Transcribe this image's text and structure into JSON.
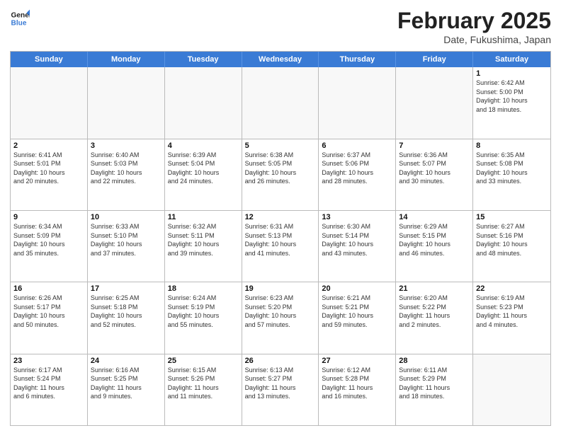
{
  "logo": {
    "line1": "General",
    "line2": "Blue"
  },
  "title": "February 2025",
  "subtitle": "Date, Fukushima, Japan",
  "weekdays": [
    "Sunday",
    "Monday",
    "Tuesday",
    "Wednesday",
    "Thursday",
    "Friday",
    "Saturday"
  ],
  "weeks": [
    [
      {
        "day": "",
        "info": ""
      },
      {
        "day": "",
        "info": ""
      },
      {
        "day": "",
        "info": ""
      },
      {
        "day": "",
        "info": ""
      },
      {
        "day": "",
        "info": ""
      },
      {
        "day": "",
        "info": ""
      },
      {
        "day": "1",
        "info": "Sunrise: 6:42 AM\nSunset: 5:00 PM\nDaylight: 10 hours\nand 18 minutes."
      }
    ],
    [
      {
        "day": "2",
        "info": "Sunrise: 6:41 AM\nSunset: 5:01 PM\nDaylight: 10 hours\nand 20 minutes."
      },
      {
        "day": "3",
        "info": "Sunrise: 6:40 AM\nSunset: 5:03 PM\nDaylight: 10 hours\nand 22 minutes."
      },
      {
        "day": "4",
        "info": "Sunrise: 6:39 AM\nSunset: 5:04 PM\nDaylight: 10 hours\nand 24 minutes."
      },
      {
        "day": "5",
        "info": "Sunrise: 6:38 AM\nSunset: 5:05 PM\nDaylight: 10 hours\nand 26 minutes."
      },
      {
        "day": "6",
        "info": "Sunrise: 6:37 AM\nSunset: 5:06 PM\nDaylight: 10 hours\nand 28 minutes."
      },
      {
        "day": "7",
        "info": "Sunrise: 6:36 AM\nSunset: 5:07 PM\nDaylight: 10 hours\nand 30 minutes."
      },
      {
        "day": "8",
        "info": "Sunrise: 6:35 AM\nSunset: 5:08 PM\nDaylight: 10 hours\nand 33 minutes."
      }
    ],
    [
      {
        "day": "9",
        "info": "Sunrise: 6:34 AM\nSunset: 5:09 PM\nDaylight: 10 hours\nand 35 minutes."
      },
      {
        "day": "10",
        "info": "Sunrise: 6:33 AM\nSunset: 5:10 PM\nDaylight: 10 hours\nand 37 minutes."
      },
      {
        "day": "11",
        "info": "Sunrise: 6:32 AM\nSunset: 5:11 PM\nDaylight: 10 hours\nand 39 minutes."
      },
      {
        "day": "12",
        "info": "Sunrise: 6:31 AM\nSunset: 5:13 PM\nDaylight: 10 hours\nand 41 minutes."
      },
      {
        "day": "13",
        "info": "Sunrise: 6:30 AM\nSunset: 5:14 PM\nDaylight: 10 hours\nand 43 minutes."
      },
      {
        "day": "14",
        "info": "Sunrise: 6:29 AM\nSunset: 5:15 PM\nDaylight: 10 hours\nand 46 minutes."
      },
      {
        "day": "15",
        "info": "Sunrise: 6:27 AM\nSunset: 5:16 PM\nDaylight: 10 hours\nand 48 minutes."
      }
    ],
    [
      {
        "day": "16",
        "info": "Sunrise: 6:26 AM\nSunset: 5:17 PM\nDaylight: 10 hours\nand 50 minutes."
      },
      {
        "day": "17",
        "info": "Sunrise: 6:25 AM\nSunset: 5:18 PM\nDaylight: 10 hours\nand 52 minutes."
      },
      {
        "day": "18",
        "info": "Sunrise: 6:24 AM\nSunset: 5:19 PM\nDaylight: 10 hours\nand 55 minutes."
      },
      {
        "day": "19",
        "info": "Sunrise: 6:23 AM\nSunset: 5:20 PM\nDaylight: 10 hours\nand 57 minutes."
      },
      {
        "day": "20",
        "info": "Sunrise: 6:21 AM\nSunset: 5:21 PM\nDaylight: 10 hours\nand 59 minutes."
      },
      {
        "day": "21",
        "info": "Sunrise: 6:20 AM\nSunset: 5:22 PM\nDaylight: 11 hours\nand 2 minutes."
      },
      {
        "day": "22",
        "info": "Sunrise: 6:19 AM\nSunset: 5:23 PM\nDaylight: 11 hours\nand 4 minutes."
      }
    ],
    [
      {
        "day": "23",
        "info": "Sunrise: 6:17 AM\nSunset: 5:24 PM\nDaylight: 11 hours\nand 6 minutes."
      },
      {
        "day": "24",
        "info": "Sunrise: 6:16 AM\nSunset: 5:25 PM\nDaylight: 11 hours\nand 9 minutes."
      },
      {
        "day": "25",
        "info": "Sunrise: 6:15 AM\nSunset: 5:26 PM\nDaylight: 11 hours\nand 11 minutes."
      },
      {
        "day": "26",
        "info": "Sunrise: 6:13 AM\nSunset: 5:27 PM\nDaylight: 11 hours\nand 13 minutes."
      },
      {
        "day": "27",
        "info": "Sunrise: 6:12 AM\nSunset: 5:28 PM\nDaylight: 11 hours\nand 16 minutes."
      },
      {
        "day": "28",
        "info": "Sunrise: 6:11 AM\nSunset: 5:29 PM\nDaylight: 11 hours\nand 18 minutes."
      },
      {
        "day": "",
        "info": ""
      }
    ]
  ]
}
